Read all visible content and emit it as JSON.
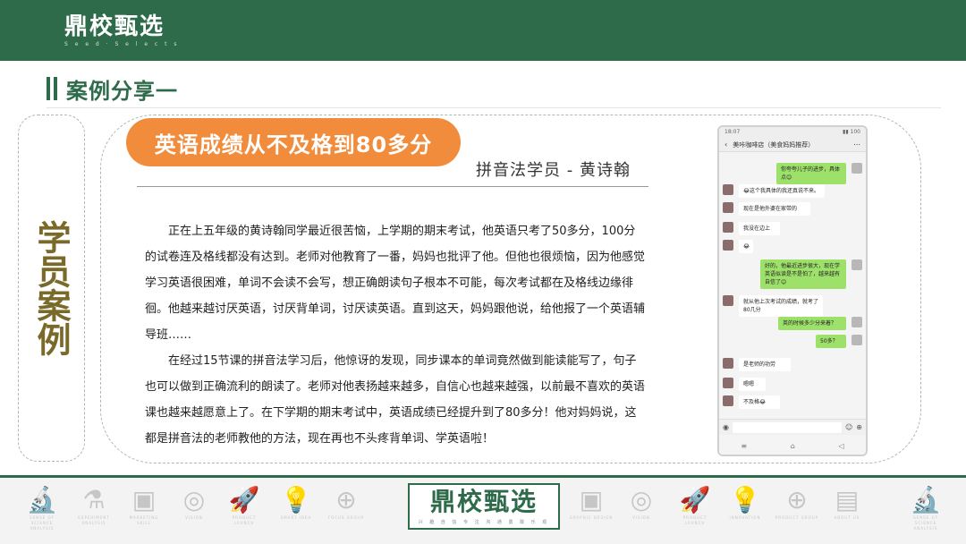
{
  "header": {
    "logo": "鼎校甄选",
    "logo_sub": "S e e d · S e l e c t s"
  },
  "section": {
    "title": "案例分享一"
  },
  "side_tag": {
    "text": "学员案例"
  },
  "card": {
    "headline": "英语成绩从不及格到80多分",
    "subtitle": "拼音法学员 - 黄诗翰",
    "paragraphs": [
      "正在上五年级的黄诗翰同学最近很苦恼，上学期的期末考试，他英语只考了50多分，100分的试卷连及格线都没有达到。老师对他教育了一番，妈妈也批评了他。但他也很烦恼，因为他感觉学习英语很困难，单词不会读不会写，想正确朗读句子根本不可能，每次考试都在及格线边缘徘徊。他越来越讨厌英语，讨厌背单词，讨厌读英语。直到这天，妈妈跟他说，给他报了一个英语辅导班……",
      "在经过15节课的拼音法学习后，他惊讶的发现，同步课本的单词竟然做到能读能写了，句子也可以做到正确流利的朗读了。老师对他表扬越来越多，自信心也越来越强，以前最不喜欢的英语课也越来越愿意上了。在下学期的期末考试中，英语成绩已经提升到了80多分！他对妈妈说，这都是拼音法的老师教他的方法，现在再也不头疼背单词、学英语啦！"
    ]
  },
  "phone": {
    "time": "18:07",
    "status_right": "▮▮ 100",
    "chat_title": "美咔咖啡店（美食妈妈推荐）",
    "messages": [
      {
        "side": "r",
        "text": "你夸夸儿子的进步，具体点😊"
      },
      {
        "side": "l",
        "text": "😂这个我具体的我还真说不来。"
      },
      {
        "side": "l",
        "text": "现在是他外婆在家带的"
      },
      {
        "side": "l",
        "text": "我没在边上"
      },
      {
        "side": "l",
        "text": "😂"
      },
      {
        "side": "r",
        "text": "好的，他最近进步很大，现在学英语似读是不是怕了，越来越有自信了😊"
      },
      {
        "side": "l",
        "text": "就从他上次考试的成绩，就考了80几分"
      },
      {
        "side": "r",
        "text": "英的时候多少分来着？"
      },
      {
        "side": "r",
        "text": "50多？"
      },
      {
        "side": "l",
        "text": "是老师的功劳"
      },
      {
        "side": "l",
        "text": "嗯嗯"
      },
      {
        "side": "l",
        "text": "不及格😂"
      }
    ]
  },
  "footer": {
    "logo": "鼎校甄选",
    "logo_sub": "兴 趣 自 信 专 注 沟 通 勇 敢 乐 观",
    "icons": [
      {
        "name": "microscope-icon",
        "glyph": "🔬",
        "label": "SENSE OF SCIENCE ANALYSIS"
      },
      {
        "name": "flask-icon",
        "glyph": "⚗",
        "label": "EXPERIMENT ANALYSIS"
      },
      {
        "name": "board-icon",
        "glyph": "▣",
        "label": "MARKETING SKILL"
      },
      {
        "name": "target-icon",
        "glyph": "◎",
        "label": "VISION"
      },
      {
        "name": "rocket-icon",
        "glyph": "🚀",
        "label": "PRODUCT LAUNCH"
      },
      {
        "name": "bulb-icon",
        "glyph": "💡",
        "label": "SMART IDEA"
      },
      {
        "name": "globe-icon",
        "glyph": "⊕",
        "label": "FOCUS GROUP"
      },
      {
        "name": "board-icon-2",
        "glyph": "▣",
        "label": "GRAPHIC DESIGN"
      },
      {
        "name": "target-icon-2",
        "glyph": "◎",
        "label": "VISION"
      },
      {
        "name": "rocket-icon-2",
        "glyph": "🚀",
        "label": "PRODUCT LAUNCH"
      },
      {
        "name": "bulb-icon-2",
        "glyph": "💡",
        "label": "INNOVATION"
      },
      {
        "name": "globe-icon-2",
        "glyph": "⊕",
        "label": "PRODUCT GROUP"
      },
      {
        "name": "book-icon",
        "glyph": "▤",
        "label": "ABOUT US"
      },
      {
        "name": "microscope-icon-2",
        "glyph": "🔬",
        "label": "SENSE OF SCIENCE ANALYSIS"
      }
    ]
  }
}
